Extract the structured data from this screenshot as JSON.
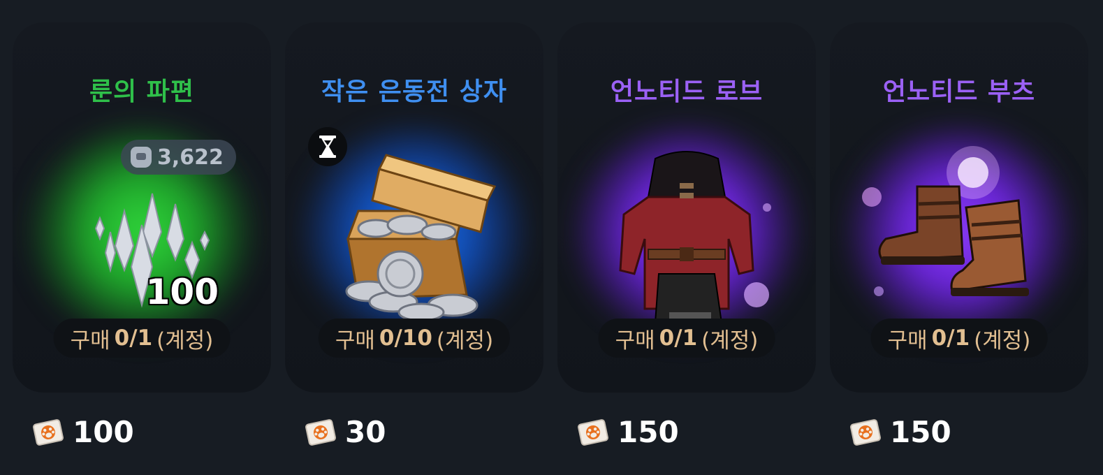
{
  "items": [
    {
      "title": "룬의 파편",
      "title_color": "#2fc04a",
      "glow": "green",
      "owned": "3,622",
      "quantity": "100",
      "limit_prefix": "구매",
      "limit_count": "0/1",
      "limit_suffix": "(계정)",
      "price": "100"
    },
    {
      "title": "작은 은동전 상자",
      "title_color": "#3f8ff0",
      "glow": "blue",
      "limit_prefix": "구매",
      "limit_count": "0/10",
      "limit_suffix": "(계정)",
      "price": "30"
    },
    {
      "title": "언노티드 로브",
      "title_color": "#9b61f5",
      "glow": "purple",
      "limit_prefix": "구매",
      "limit_count": "0/1",
      "limit_suffix": "(계정)",
      "price": "150"
    },
    {
      "title": "언노티드 부츠",
      "title_color": "#9b61f5",
      "glow": "purple",
      "limit_prefix": "구매",
      "limit_count": "0/1",
      "limit_suffix": "(계정)",
      "price": "150"
    }
  ],
  "icons": {
    "currency": "paw-ticket-icon",
    "timer": "hourglass-icon",
    "owned": "bag-icon"
  },
  "colors": {
    "background": "#171c23",
    "limit_text": "#e2bf91",
    "ticket": "#e8701e"
  }
}
